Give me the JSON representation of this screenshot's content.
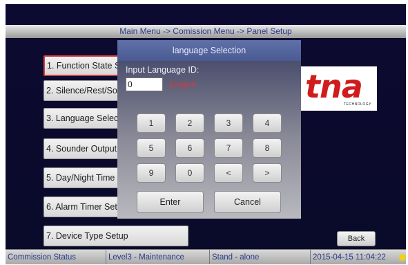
{
  "header": {
    "breadcrumb": "Main Menu -> Comission Menu -> Panel Setup"
  },
  "menu": {
    "items": [
      {
        "label": "1. Function State Setup"
      },
      {
        "label": "2. Silence/Rest/Sound"
      },
      {
        "label": "3. Language Selection"
      },
      {
        "label": "4. Sounder Output"
      },
      {
        "label": "5. Day/Night Time"
      },
      {
        "label": "6. Alarm Timer Setup"
      },
      {
        "label": "7. Device Type Setup"
      }
    ]
  },
  "logo": {
    "mark": "tna",
    "sub": "TECHNOLOGY"
  },
  "back_label": "Back",
  "dialog": {
    "title": "language Selection",
    "input_label": "Input Language ID:",
    "input_value": "0",
    "language_name": "English",
    "keys": [
      "1",
      "2",
      "3",
      "4",
      "5",
      "6",
      "7",
      "8",
      "9",
      "0",
      "<",
      ">"
    ],
    "enter_label": "Enter",
    "cancel_label": "Cancel"
  },
  "status": {
    "cells": [
      "Commission Status",
      "Level3 - Maintenance",
      "Stand - alone",
      "2015-04-15 11:04:22"
    ]
  },
  "colors": {
    "accent_red": "#d01c1c",
    "status_dot": "#f2cf1a"
  }
}
